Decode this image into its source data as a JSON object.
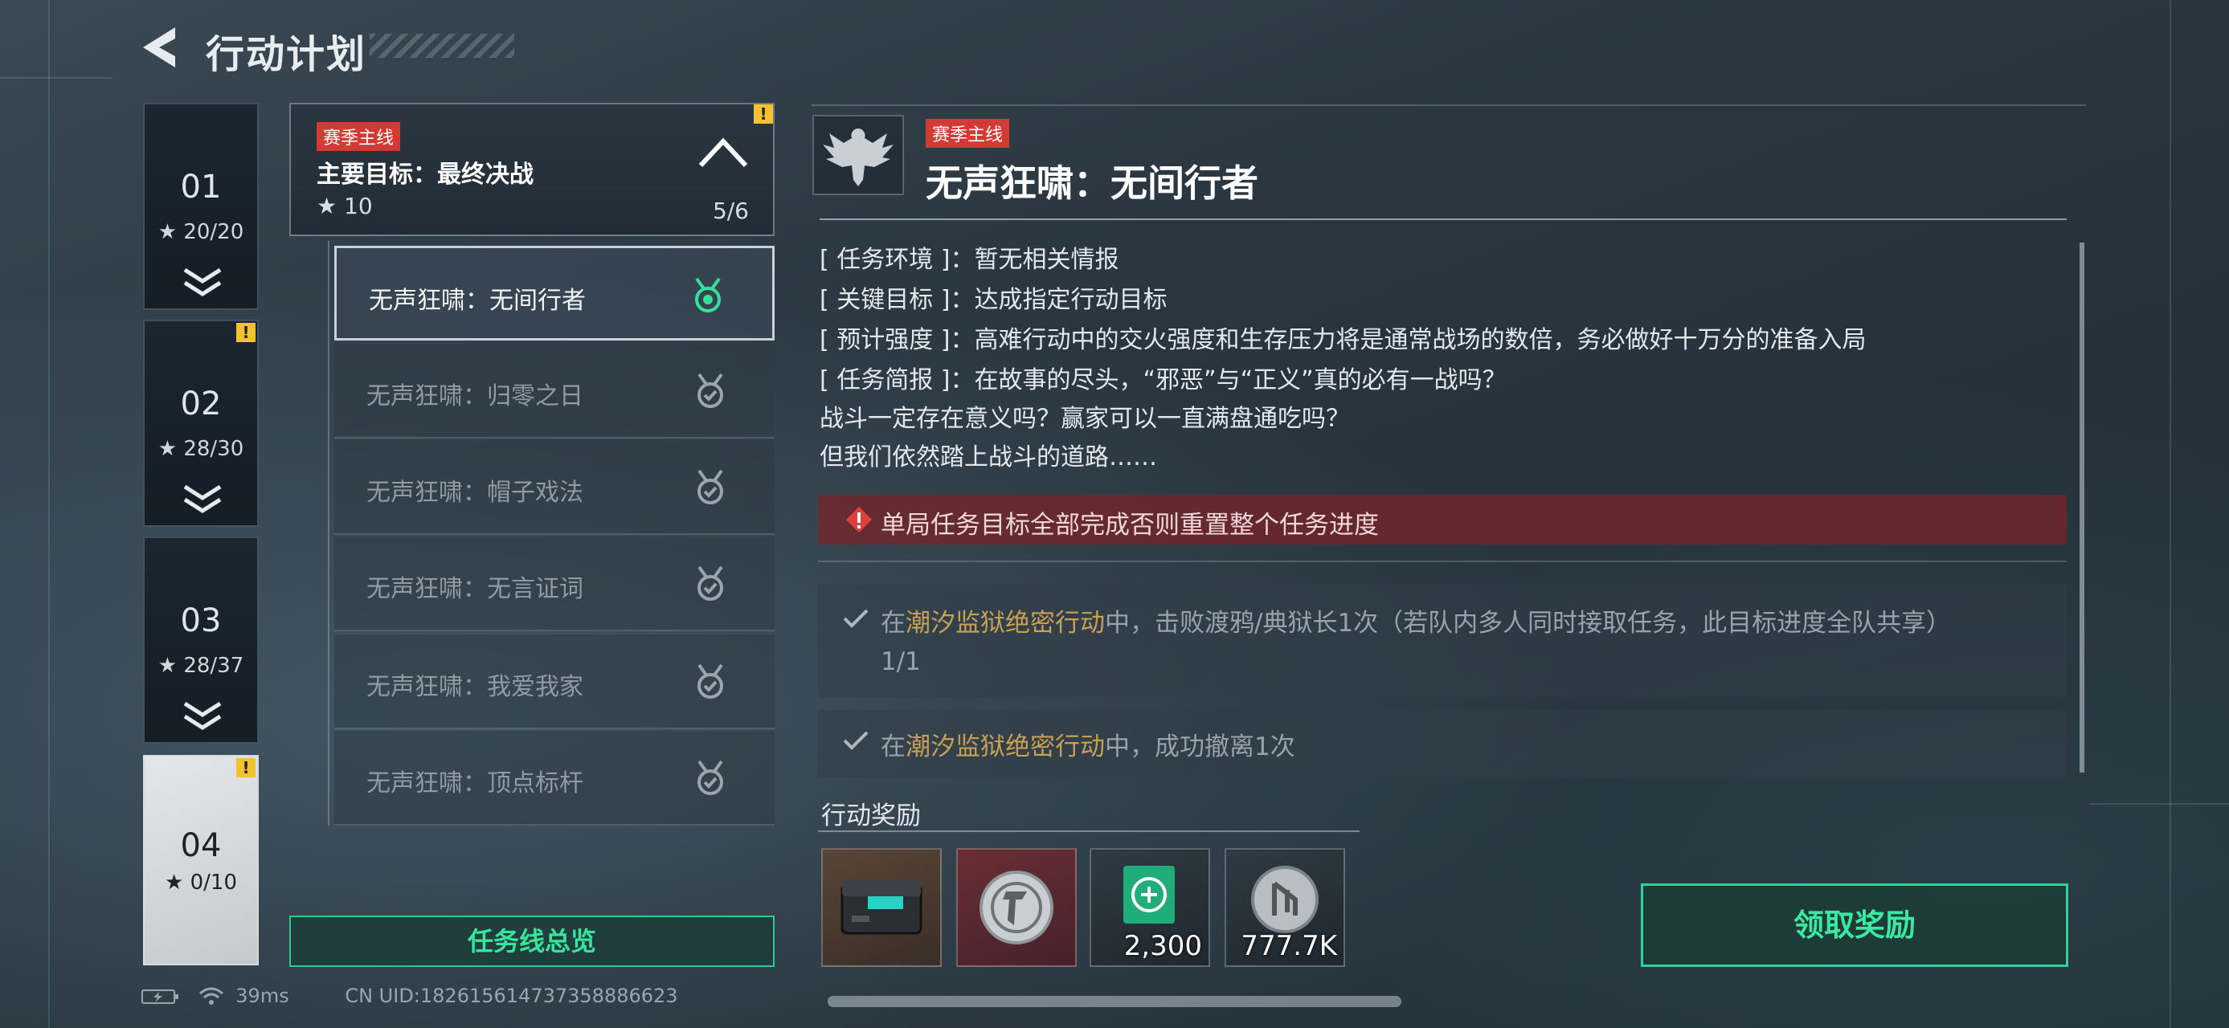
{
  "header": {
    "title": "行动计划"
  },
  "chapters": [
    {
      "num": "01",
      "stars": "20/20"
    },
    {
      "num": "02",
      "stars": "28/30"
    },
    {
      "num": "03",
      "stars": "28/37"
    },
    {
      "num": "04",
      "stars": "0/10"
    }
  ],
  "main_goal": {
    "tag": "赛季主线",
    "goal": "主要目标：最终决战",
    "score": "10",
    "progress": "5/6"
  },
  "missions": [
    "无声狂啸：无间行者",
    "无声狂啸：归零之日",
    "无声狂啸：帽子戏法",
    "无声狂啸：无言证词",
    "无声狂啸：我爱我家",
    "无声狂啸：顶点标杆"
  ],
  "overview_button": "任务线总览",
  "status": {
    "ping": "39ms",
    "uid": "CN UID:182615614737358886623"
  },
  "detail": {
    "tag": "赛季主线",
    "title": "无声狂啸：无间行者",
    "info": [
      {
        "key": "[ 任务环境 ]",
        "value": "：暂无相关情报"
      },
      {
        "key": "[ 关键目标 ]",
        "value": "：达成指定行动目标"
      },
      {
        "key": "[ 预计强度 ]",
        "value": "：高难行动中的交火强度和生存压力将是通常战场的数倍，务必做好十万分的准备入局"
      },
      {
        "key": "[ 任务简报 ]",
        "value": "：在故事的尽头，“邪恶”与“正义”真的必有一战吗？"
      },
      {
        "key": "",
        "value": "战斗一定存在意义吗？赢家可以一直满盘通吃吗？"
      },
      {
        "key": "",
        "value": "但我们依然踏上战斗的道路……"
      }
    ],
    "warning": "单局任务目标全部完成否则重置整个任务进度",
    "objectives": [
      {
        "prefix": "在",
        "highlight": "潮汐监狱绝密行动",
        "suffix": "中，击败渡鸦/典狱长1次（若队内多人同时接取任务，此目标进度全队共享）",
        "count": "1/1"
      },
      {
        "prefix": "在",
        "highlight": "潮汐监狱绝密行动",
        "suffix": "中，成功撤离1次",
        "count": ""
      }
    ],
    "reward_label": "行动奖励",
    "rewards": [
      {
        "icon": "equipment-case-icon",
        "qty": ""
      },
      {
        "icon": "badge-emblem-icon",
        "qty": ""
      },
      {
        "icon": "green-token-icon",
        "qty": "2,300"
      },
      {
        "icon": "silver-coin-icon",
        "qty": "777.7K"
      }
    ],
    "claim_button": "领取奖励"
  },
  "colors": {
    "accent_green": "#2fd39a",
    "tag_red": "#d23a34",
    "highlight_gold": "#c9a052",
    "warn_yellow": "#f2c230"
  }
}
